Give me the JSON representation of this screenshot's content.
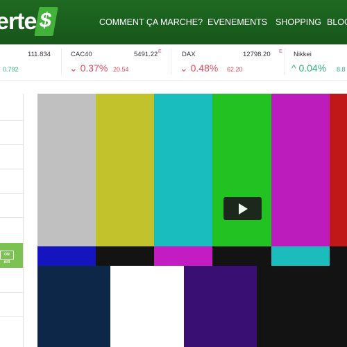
{
  "header": {
    "logo_text": "erte",
    "logo_badge": "$",
    "nav": [
      "COMMENT ÇA MARCHE?",
      "EVENEMENTS",
      "SHOPPING",
      "BLOG"
    ]
  },
  "ticker": [
    {
      "name": "",
      "price": "111.834",
      "pct": "",
      "change": "0.792",
      "direction": "up"
    },
    {
      "name": "CAC40",
      "price": "5491.22",
      "sup": "E",
      "pct": "0.37%",
      "change": "20.54",
      "direction": "down"
    },
    {
      "name": "DAX",
      "price": "12798.20",
      "sup": "E",
      "pct": "0.48%",
      "change": "62.20",
      "direction": "down"
    },
    {
      "name": "Nikkei",
      "price": "",
      "pct": "0.04%",
      "change": "8.8",
      "direction": "up"
    }
  ],
  "sidebar": {
    "onair_label": "ON AIR"
  },
  "video": {
    "play_icon": "play-icon",
    "bars_top": [
      "#c0c0c0",
      "#c2c22c",
      "#19bdbd",
      "#22c222",
      "#bc1cbc",
      "#c01818"
    ],
    "bars_mid": [
      "#1515bf",
      "#131313",
      "#c21cc2",
      "#131313",
      "#1cbcbc",
      "#131313"
    ],
    "bars_bottom": [
      "#0c2747",
      "#ffffff",
      "#3a0f74",
      "#131313",
      "#131313"
    ]
  },
  "colors": {
    "header_green": "#1b5e20",
    "logo_badge_green": "#43b23a",
    "ticker_down": "#e14a5b",
    "ticker_up": "#2fb27d",
    "onair_green": "#7cc252"
  }
}
